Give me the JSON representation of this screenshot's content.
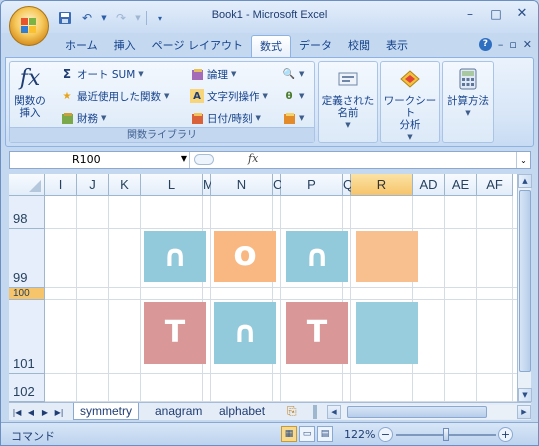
{
  "window": {
    "title": "Book1 - Microsoft Excel",
    "buttons": [
      "–",
      "□",
      "✕"
    ]
  },
  "qat": [
    "save-icon",
    "undo-icon",
    "redo-icon",
    "customize-icon"
  ],
  "tabs": [
    {
      "label": "ホーム"
    },
    {
      "label": "挿入"
    },
    {
      "label": "ページ レイアウト"
    },
    {
      "label": "数式",
      "active": true
    },
    {
      "label": "データ"
    },
    {
      "label": "校閲"
    },
    {
      "label": "表示"
    }
  ],
  "ribbon": {
    "insert_function": "関数の\n挿入",
    "autosum": "オート SUM",
    "recent": "最近使用した関数",
    "financial": "財務",
    "logical": "論理",
    "text": "文字列操作",
    "datetime": "日付/時刻",
    "library_label": "関数ライブラリ",
    "defined_names": "定義された\n名前",
    "worksheet_analysis": "ワークシート\n分析",
    "calc_options": "計算方法"
  },
  "formula_bar": {
    "name_box": "R100",
    "fx": "fx",
    "formula": ""
  },
  "columns": [
    {
      "label": "I",
      "selected": false
    },
    {
      "label": "J",
      "selected": false
    },
    {
      "label": "K",
      "selected": false
    },
    {
      "label": "L",
      "selected": false
    },
    {
      "label": "M",
      "selected": false
    },
    {
      "label": "N",
      "selected": false
    },
    {
      "label": "C",
      "selected": false
    },
    {
      "label": "P",
      "selected": false
    },
    {
      "label": "Q",
      "selected": false
    },
    {
      "label": "R",
      "selected": true
    },
    {
      "label": "AD",
      "selected": false
    },
    {
      "label": "AE",
      "selected": false
    },
    {
      "label": "AF",
      "selected": false
    }
  ],
  "rows": [
    "98",
    "99",
    "100",
    "101",
    "102"
  ],
  "cells": [
    {
      "glyph": "∩",
      "color": "#92c9db"
    },
    {
      "glyph": "o",
      "color": "#f9b882"
    },
    {
      "glyph": "∩",
      "color": "#92c9db"
    },
    {
      "glyph": "",
      "color": "#f9c08f"
    },
    {
      "glyph": "T",
      "color": "#da9797"
    },
    {
      "glyph": "∩",
      "color": "#92c9db"
    },
    {
      "glyph": "T",
      "color": "#da9797"
    },
    {
      "glyph": "",
      "color": "#97cddc"
    }
  ],
  "sheet_tabs": [
    {
      "label": "symmetry",
      "active": true
    },
    {
      "label": "anagram",
      "active": false
    },
    {
      "label": "alphabet",
      "active": false
    }
  ],
  "status": {
    "mode": "コマンド",
    "zoom": "122%"
  }
}
